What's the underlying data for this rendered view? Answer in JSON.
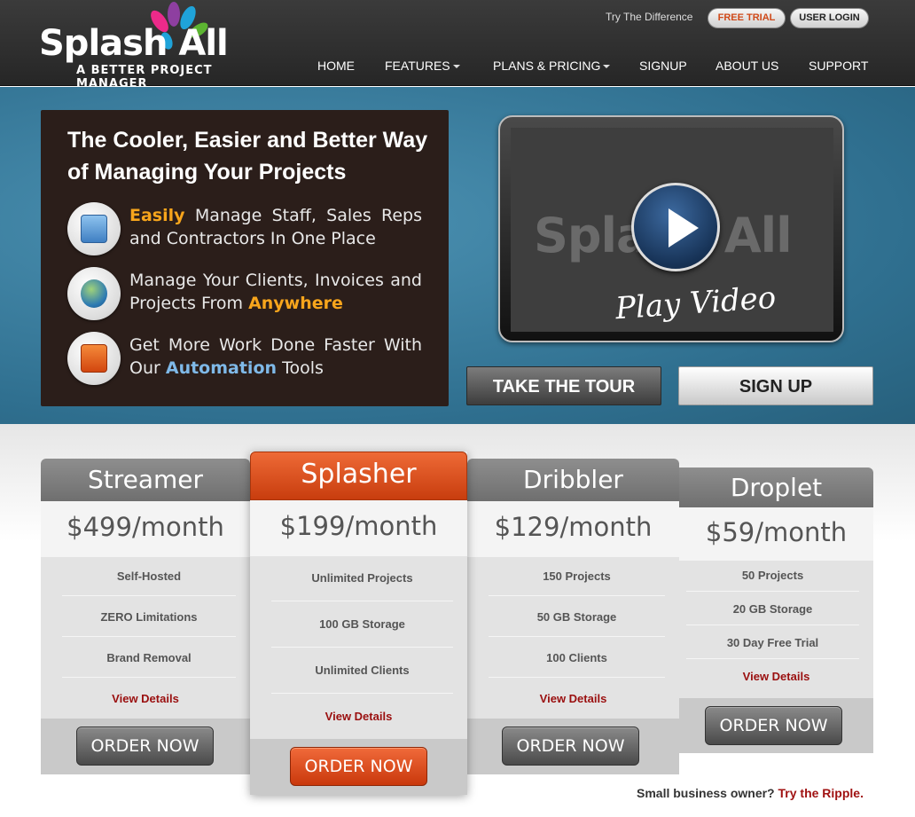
{
  "header": {
    "logo_text": "Splash All",
    "logo_tagline": "A BETTER PROJECT MANAGER",
    "try_link": "Try The Difference",
    "free_trial": "FREE TRIAL",
    "user_login": "USER LOGIN",
    "nav": [
      "HOME",
      "FEATURES",
      "PLANS & PRICING",
      "SIGNUP",
      "ABOUT US",
      "SUPPORT"
    ]
  },
  "hero": {
    "title": "The Cooler, Easier and Better Way of Managing Your Projects",
    "features": [
      {
        "highlight": "Easily",
        "text": " Manage Staff, Sales Reps and Contractors In One Place",
        "icon": "cabinet-icon"
      },
      {
        "text": "Manage Your Clients, Invoices and Projects From ",
        "highlight": "Anywhere",
        "icon": "globe-icon"
      },
      {
        "text": "Get More Work Done Faster With Our ",
        "highlight": "Automation",
        "text2": " Tools",
        "icon": "gear-icon"
      }
    ],
    "video_label": "Play Video",
    "video_watermark": "Splash All",
    "tour_button": "TAKE THE TOUR",
    "signup_button": "SIGN UP"
  },
  "plans": [
    {
      "name": "Streamer",
      "price": "$499/month",
      "features": [
        "Self-Hosted",
        "ZERO Limitations",
        "Brand Removal"
      ],
      "link": "View Details",
      "order": "ORDER NOW"
    },
    {
      "name": "Splasher",
      "price": "$199/month",
      "features": [
        "Unlimited Projects",
        "100 GB Storage",
        "Unlimited Clients"
      ],
      "link": "View Details",
      "order": "ORDER NOW"
    },
    {
      "name": "Dribbler",
      "price": "$129/month",
      "features": [
        "150 Projects",
        "50 GB Storage",
        "100 Clients"
      ],
      "link": "View Details",
      "order": "ORDER NOW"
    },
    {
      "name": "Droplet",
      "price": "$59/month",
      "features": [
        "50 Projects",
        "20 GB Storage",
        "30 Day Free Trial"
      ],
      "link": "View Details",
      "order": "ORDER NOW"
    }
  ],
  "footer": {
    "question": "Small business owner?",
    "link": "Try the Ripple."
  },
  "colors": {
    "accent_orange": "#d9541e",
    "header_bg": "#2f2f2f",
    "hero_bg": "#3a7fa0",
    "link_red": "#9a0f0f"
  }
}
